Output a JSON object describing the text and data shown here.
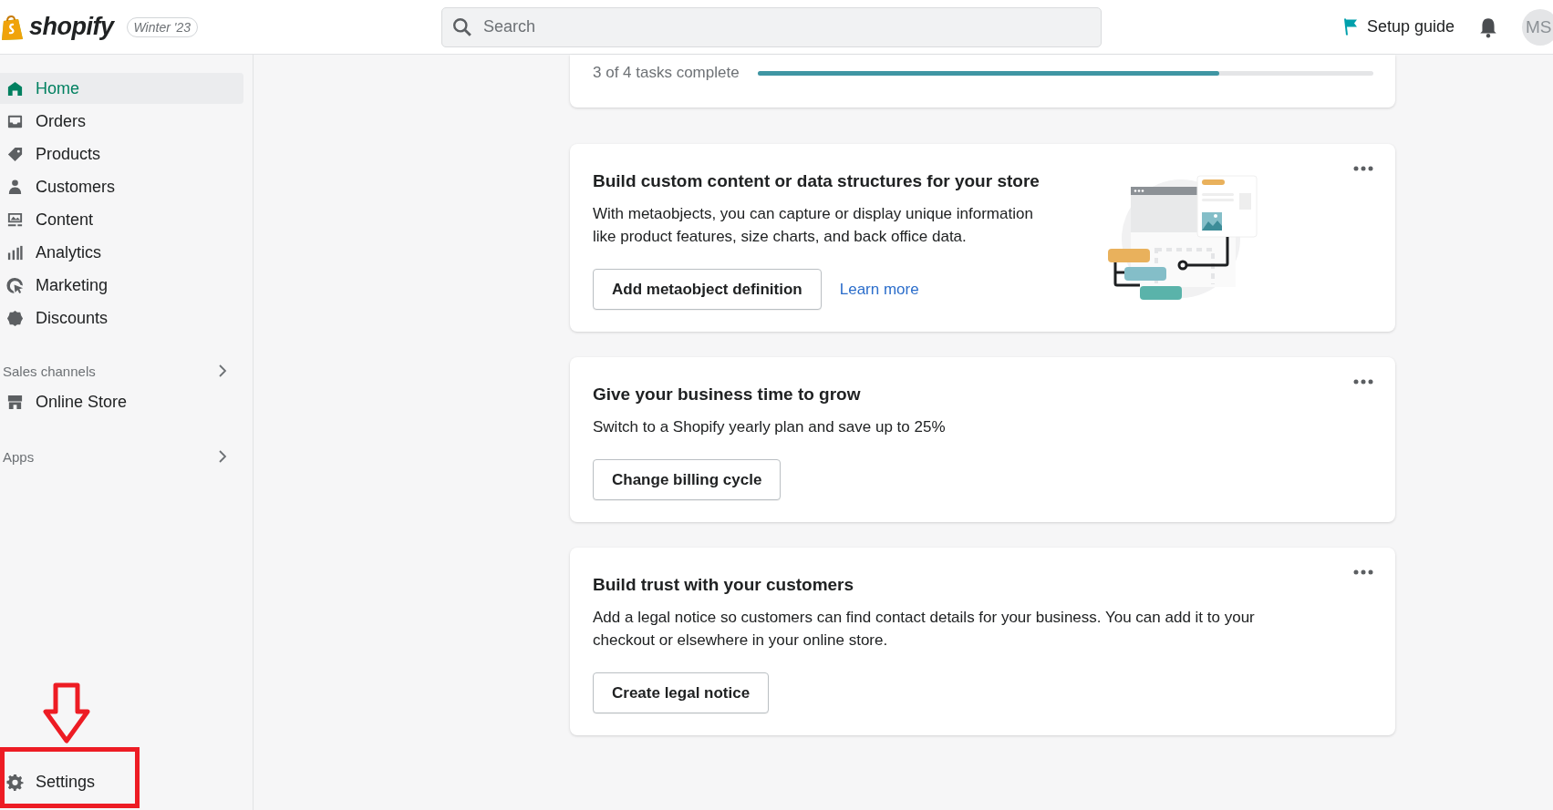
{
  "topbar": {
    "brand": "shopify",
    "edition_badge": "Winter '23",
    "search": {
      "placeholder": "Search"
    },
    "setup_guide": "Setup guide",
    "avatar_initials": "MS"
  },
  "sidebar": {
    "items": [
      {
        "label": "Home",
        "selected": true
      },
      {
        "label": "Orders",
        "selected": false
      },
      {
        "label": "Products",
        "selected": false
      },
      {
        "label": "Customers",
        "selected": false
      },
      {
        "label": "Content",
        "selected": false
      },
      {
        "label": "Analytics",
        "selected": false
      },
      {
        "label": "Marketing",
        "selected": false
      },
      {
        "label": "Discounts",
        "selected": false
      }
    ],
    "sales_channels": {
      "heading": "Sales channels",
      "items": [
        {
          "label": "Online Store",
          "selected": false
        }
      ]
    },
    "apps": {
      "heading": "Apps"
    },
    "settings": {
      "label": "Settings"
    }
  },
  "progress": {
    "text": "3 of 4 tasks complete",
    "level": 0.75
  },
  "cards": [
    {
      "title": "Build custom content or data structures for your store",
      "body": "With metaobjects, you can capture or display unique information like product features, size charts, and back office data.",
      "illustration": true,
      "actions": [
        {
          "kind": "button",
          "label": "Add metaobject definition"
        },
        {
          "kind": "link",
          "label": "Learn more"
        }
      ]
    },
    {
      "title": "Give your business time to grow",
      "body": "Switch to a Shopify yearly plan and save up to 25%",
      "illustration": false,
      "actions": [
        {
          "kind": "button",
          "label": "Change billing cycle"
        }
      ]
    },
    {
      "title": "Build trust with your customers",
      "body": "Add a legal notice so customers can find contact details for your business. You can add it to your checkout or elsewhere in your online store.",
      "illustration": false,
      "actions": [
        {
          "kind": "button",
          "label": "Create legal notice"
        }
      ]
    }
  ]
}
